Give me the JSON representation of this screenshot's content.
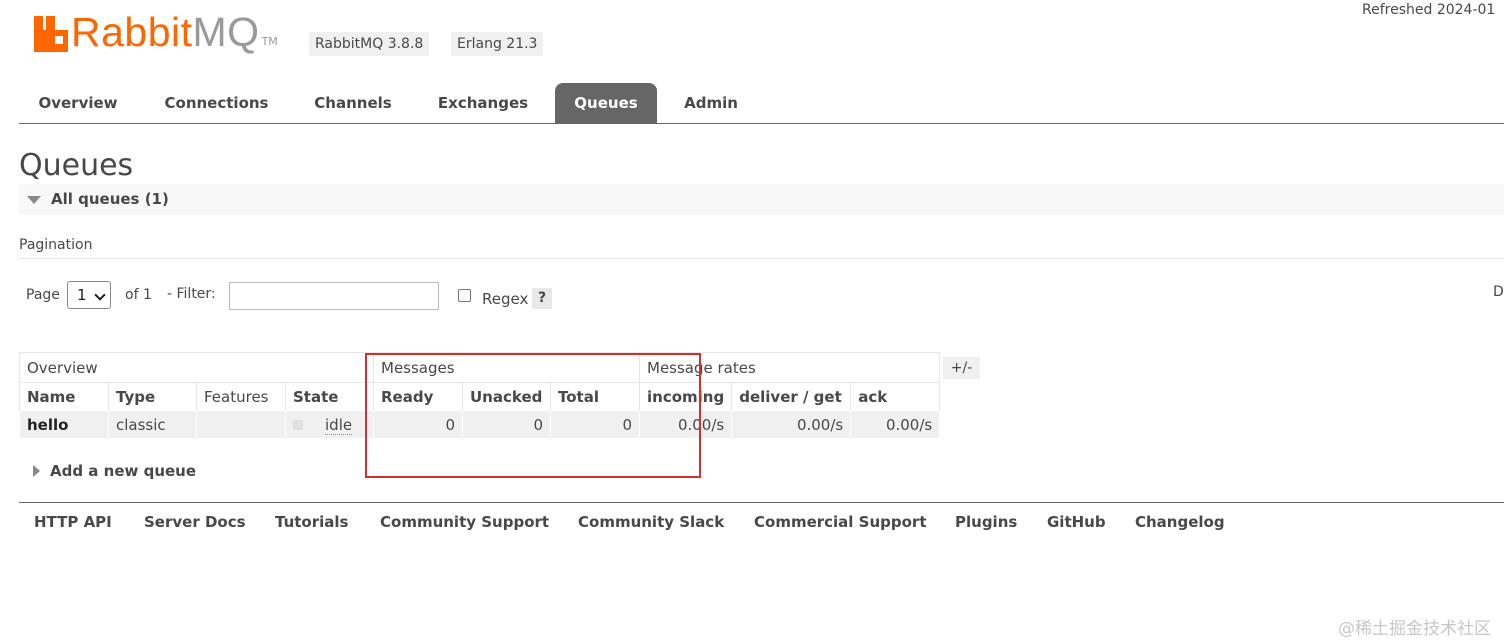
{
  "brand": {
    "name_primary": "Rabbit",
    "name_secondary": "MQ",
    "trademark": "TM",
    "accent_color": "#ff6600"
  },
  "versions": {
    "rabbitmq": "RabbitMQ 3.8.8",
    "erlang": "Erlang 21.3"
  },
  "refreshed": "Refreshed 2024-01",
  "nav": {
    "tabs": [
      "Overview",
      "Connections",
      "Channels",
      "Exchanges",
      "Queues",
      "Admin"
    ],
    "active": "Queues"
  },
  "page": {
    "title": "Queues",
    "section": "All queues (1)"
  },
  "pagination": {
    "heading": "Pagination",
    "page_label": "Page",
    "page_value": "1",
    "of_label": "of 1",
    "filter_label": "- Filter:",
    "filter_value": "",
    "regex_label": "Regex",
    "help_label": "?",
    "right_edge_text": "D"
  },
  "table": {
    "groups": [
      "Overview",
      "Messages",
      "Message rates"
    ],
    "columns": [
      "Name",
      "Type",
      "Features",
      "State",
      "Ready",
      "Unacked",
      "Total",
      "incoming",
      "deliver / get",
      "ack"
    ],
    "rows": [
      {
        "name": "hello",
        "type": "classic",
        "features": "",
        "state": "idle",
        "ready": "0",
        "unacked": "0",
        "total": "0",
        "incoming": "0.00/s",
        "deliver_get": "0.00/s",
        "ack": "0.00/s"
      }
    ],
    "toggle_label": "+/-"
  },
  "highlight_color": "#d32f2f",
  "add_queue": "Add a new queue",
  "footer": [
    "HTTP API",
    "Server Docs",
    "Tutorials",
    "Community Support",
    "Community Slack",
    "Commercial Support",
    "Plugins",
    "GitHub",
    "Changelog"
  ],
  "watermark": "@稀土掘金技术社区"
}
